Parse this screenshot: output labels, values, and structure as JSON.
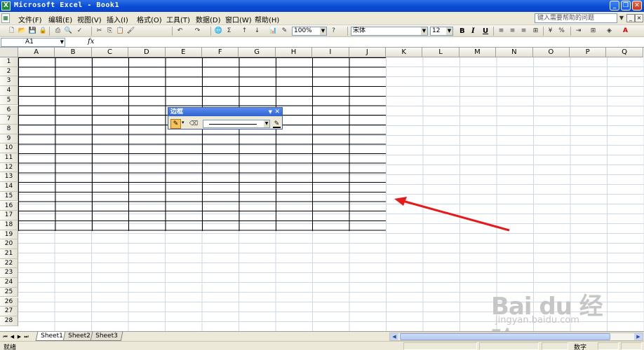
{
  "window": {
    "title": "Microsoft Excel - Book1",
    "icon": "X"
  },
  "menu": [
    {
      "label": "文件(F)"
    },
    {
      "label": "编辑(E)"
    },
    {
      "label": "视图(V)"
    },
    {
      "label": "插入(I)"
    },
    {
      "label": "格式(O)"
    },
    {
      "label": "工具(T)"
    },
    {
      "label": "数据(D)"
    },
    {
      "label": "窗口(W)"
    },
    {
      "label": "帮助(H)"
    }
  ],
  "help": {
    "placeholder": "键入需要帮助的问题"
  },
  "toolbar": {
    "zoom": "100%",
    "font": "宋体",
    "size": "12",
    "bold": "B",
    "italic": "I",
    "underline": "U",
    "sum": "Σ",
    "percent": "%"
  },
  "formula": {
    "namebox": "A1",
    "fx": "fx",
    "value": ""
  },
  "columns": [
    "A",
    "B",
    "C",
    "D",
    "E",
    "F",
    "G",
    "H",
    "I",
    "J",
    "K",
    "L",
    "M",
    "N",
    "O",
    "P",
    "Q"
  ],
  "rows": [
    "1",
    "2",
    "3",
    "4",
    "5",
    "6",
    "7",
    "8",
    "9",
    "10",
    "11",
    "12",
    "13",
    "14",
    "15",
    "16",
    "17",
    "18",
    "19",
    "20",
    "21",
    "22",
    "23",
    "24",
    "25",
    "26",
    "27",
    "28"
  ],
  "border_toolbar": {
    "title": "边框"
  },
  "sheets": [
    {
      "label": "Sheet1",
      "active": true
    },
    {
      "label": "Sheet2"
    },
    {
      "label": "Sheet3"
    }
  ],
  "status": {
    "left": "就绪",
    "right": "数字"
  },
  "watermark": {
    "logo": "Bai du 经验",
    "url": "jingyan.baidu.com"
  },
  "colors": {
    "annotation_arrow": "#e51b1b",
    "titlebar": "#0a4bd6"
  }
}
